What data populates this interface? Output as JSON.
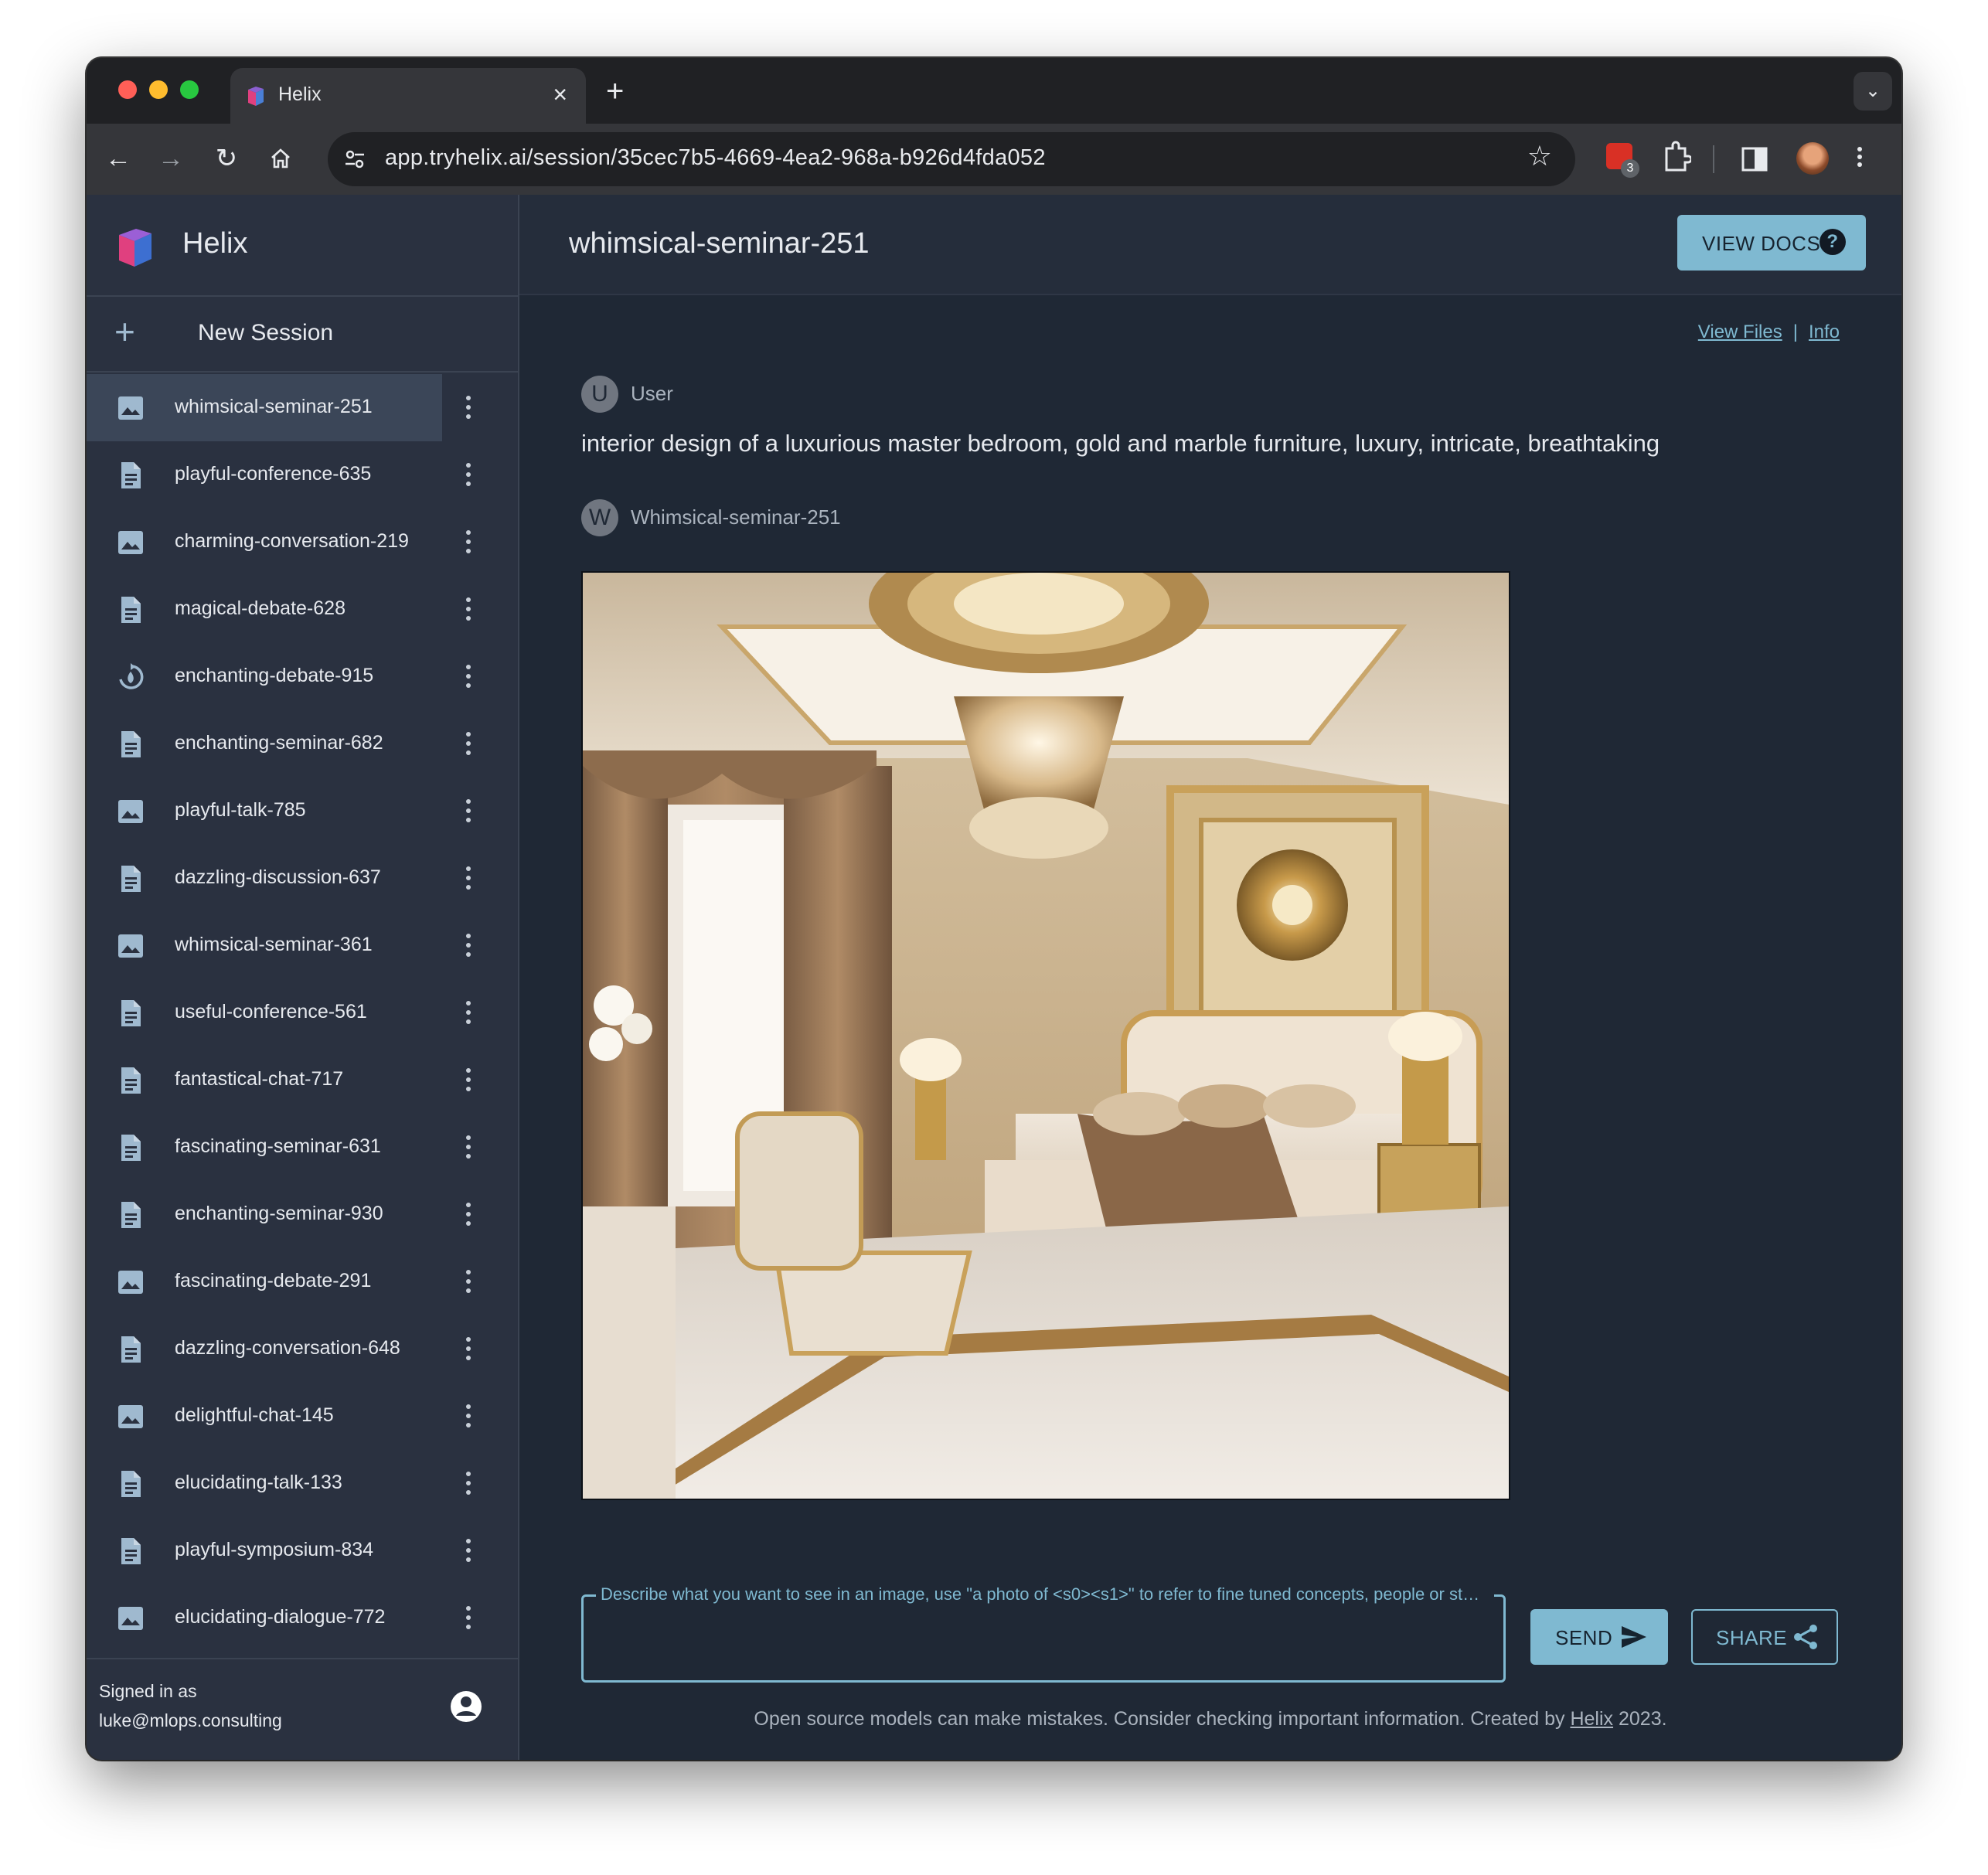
{
  "browser": {
    "tab_title": "Helix",
    "url": "app.tryhelix.ai/session/35cec7b5-4669-4ea2-968a-b926d4fda052",
    "extension_badge": "3"
  },
  "sidebar": {
    "brand": "Helix",
    "new_session_label": "New Session",
    "sessions": [
      {
        "label": "whimsical-seminar-251",
        "icon": "image-icon",
        "active": true
      },
      {
        "label": "playful-conference-635",
        "icon": "document-icon"
      },
      {
        "label": "charming-conversation-219",
        "icon": "image-icon"
      },
      {
        "label": "magical-debate-628",
        "icon": "document-icon"
      },
      {
        "label": "enchanting-debate-915",
        "icon": "loading-icon"
      },
      {
        "label": "enchanting-seminar-682",
        "icon": "document-icon"
      },
      {
        "label": "playful-talk-785",
        "icon": "image-icon"
      },
      {
        "label": "dazzling-discussion-637",
        "icon": "document-icon"
      },
      {
        "label": "whimsical-seminar-361",
        "icon": "image-icon"
      },
      {
        "label": "useful-conference-561",
        "icon": "document-icon"
      },
      {
        "label": "fantastical-chat-717",
        "icon": "document-icon"
      },
      {
        "label": "fascinating-seminar-631",
        "icon": "document-icon"
      },
      {
        "label": "enchanting-seminar-930",
        "icon": "document-icon"
      },
      {
        "label": "fascinating-debate-291",
        "icon": "image-icon"
      },
      {
        "label": "dazzling-conversation-648",
        "icon": "document-icon"
      },
      {
        "label": "delightful-chat-145",
        "icon": "image-icon"
      },
      {
        "label": "elucidating-talk-133",
        "icon": "document-icon"
      },
      {
        "label": "playful-symposium-834",
        "icon": "document-icon"
      },
      {
        "label": "elucidating-dialogue-772",
        "icon": "image-icon"
      }
    ],
    "signed_in_label": "Signed in as",
    "signed_in_email": "luke@mlops.consulting"
  },
  "main": {
    "session_title": "whimsical-seminar-251",
    "view_docs_label": "VIEW DOCS",
    "view_files_label": "View Files",
    "info_label": "Info",
    "user_avatar": "U",
    "user_name": "User",
    "prompt": "interior design of a luxurious master bedroom, gold and marble furniture, luxury, intricate, breathtaking",
    "assistant_avatar": "W",
    "assistant_name": "Whimsical-seminar-251",
    "input_label": "Describe what you want to see in an image, use \"a photo of <s0><s1>\" to refer to fine tuned concepts, people or st…",
    "input_value": "",
    "send_label": "SEND",
    "share_label": "SHARE",
    "footer_text": "Open source models can make mistakes. Consider checking important information. Created by ",
    "footer_link": "Helix",
    "footer_year": " 2023."
  },
  "colors": {
    "accent": "#7fb9d1",
    "sidebar_bg": "#2a3140",
    "main_bg": "#1f2835",
    "active_session_bg": "#3b4658"
  }
}
